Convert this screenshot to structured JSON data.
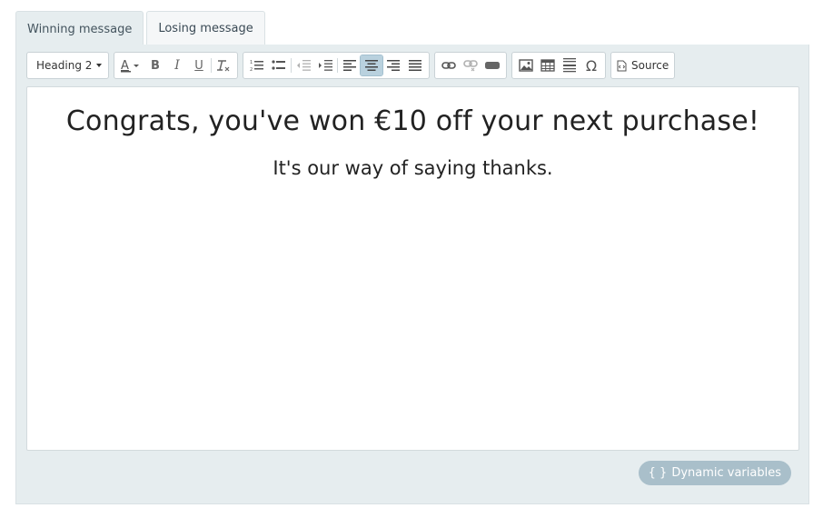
{
  "tabs": [
    {
      "label": "Winning message",
      "active": true
    },
    {
      "label": "Losing message",
      "active": false
    }
  ],
  "toolbar": {
    "format_label": "Heading 2",
    "source_label": "Source"
  },
  "editor": {
    "heading": "Congrats, you've won €10 off your next purchase!",
    "paragraph": "It's our way of saying thanks."
  },
  "dynamic_variables": {
    "brace": "{ }",
    "label": "Dynamic variables"
  },
  "colors": {
    "panel_bg": "#e6edef",
    "active_button": "#b9d1de",
    "pill_bg": "#a9bfca"
  }
}
